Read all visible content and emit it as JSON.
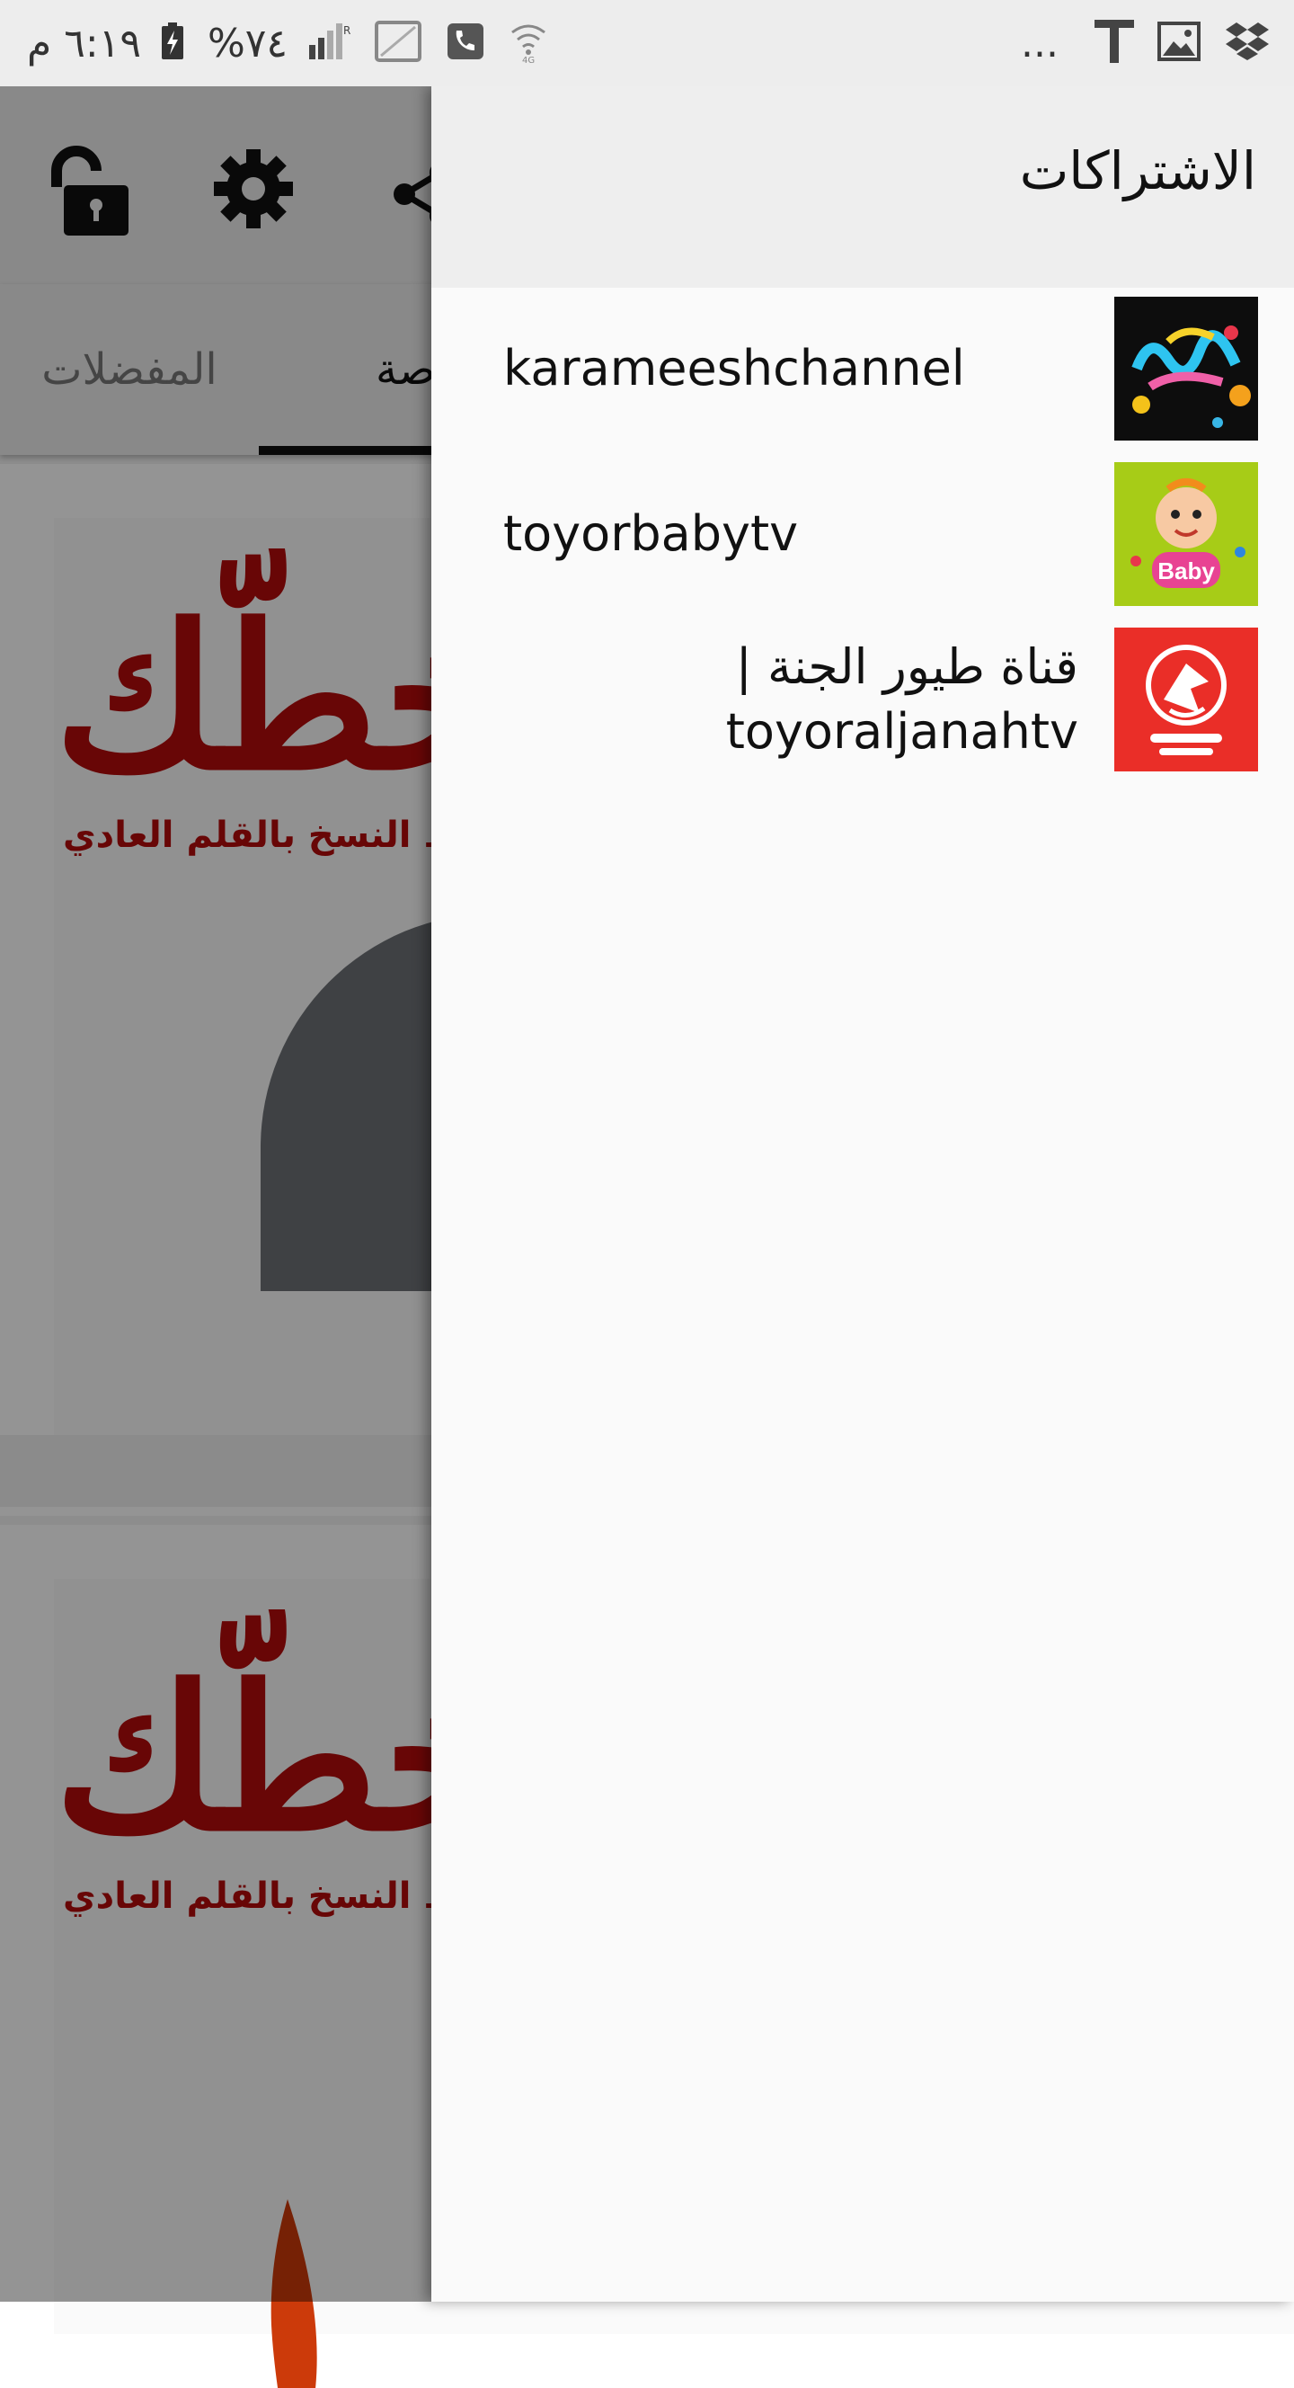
{
  "status_bar": {
    "time": "٦:١٩ م",
    "battery": "%٧٤",
    "overflow": "..."
  },
  "background_app": {
    "tabs": [
      {
        "label": "المفضلات"
      },
      {
        "label": "الخاصة"
      }
    ],
    "cards": [
      {
        "title": "خطّك",
        "subtitle": "بخط النسخ بالقلم العادي"
      },
      {
        "title": "خطّك",
        "subtitle": "بخط النسخ بالقلم العادي"
      }
    ]
  },
  "drawer": {
    "title": "الاشتراكات",
    "subscriptions": [
      {
        "name": "karameeshchannel",
        "thumb_color": "#111111"
      },
      {
        "name": "toyorbabytv",
        "thumb_color": "#a7cc17"
      },
      {
        "name": "قناة طيور الجنة | toyoraljanahtv",
        "thumb_color": "#ea2e28"
      }
    ]
  },
  "icons": {
    "unlock": "unlock-icon",
    "settings": "gear-icon",
    "share": "share-icon"
  }
}
